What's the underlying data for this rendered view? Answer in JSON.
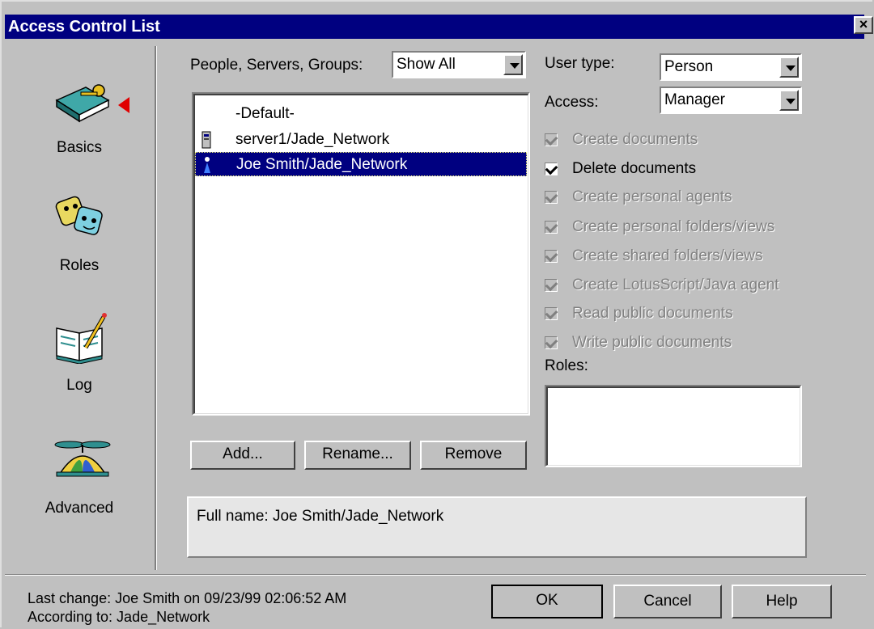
{
  "window": {
    "title": "Access Control List",
    "close_glyph": "×"
  },
  "sidebar": {
    "items": [
      {
        "label": "Basics",
        "icon": "book-key-icon",
        "active": true
      },
      {
        "label": "Roles",
        "icon": "masks-icon"
      },
      {
        "label": "Log",
        "icon": "open-book-pencil-icon"
      },
      {
        "label": "Advanced",
        "icon": "propeller-beanie-icon"
      }
    ]
  },
  "filter": {
    "label": "People, Servers, Groups:",
    "value": "Show All"
  },
  "user_type": {
    "label": "User type:",
    "value": "Person"
  },
  "access": {
    "label": "Access:",
    "value": "Manager"
  },
  "entries": [
    {
      "name": "-Default-",
      "icon": ""
    },
    {
      "name": "server1/Jade_Network",
      "icon": "server-icon"
    },
    {
      "name": "Joe Smith/Jade_Network",
      "icon": "person-icon",
      "selected": true
    }
  ],
  "permissions": [
    {
      "label": "Create documents",
      "checked": true,
      "enabled": false
    },
    {
      "label": "Delete documents",
      "checked": true,
      "enabled": true
    },
    {
      "label": "Create personal agents",
      "checked": true,
      "enabled": false
    },
    {
      "label": "Create personal folders/views",
      "checked": true,
      "enabled": false
    },
    {
      "label": "Create shared folders/views",
      "checked": true,
      "enabled": false
    },
    {
      "label": "Create LotusScript/Java agent",
      "checked": true,
      "enabled": false
    },
    {
      "label": "Read public documents",
      "checked": true,
      "enabled": false
    },
    {
      "label": "Write public documents",
      "checked": true,
      "enabled": false
    }
  ],
  "roles": {
    "label": "Roles:"
  },
  "list_buttons": {
    "add": "Add...",
    "rename": "Rename...",
    "remove": "Remove"
  },
  "full_name": "Full name:  Joe Smith/Jade_Network",
  "footer": {
    "last_change": "Last change:  Joe Smith on 09/23/99 02:06:52 AM",
    "according_to": "According to:  Jade_Network",
    "ok": "OK",
    "cancel": "Cancel",
    "help": "Help"
  },
  "colors": {
    "titlebar": "#000080",
    "selection": "#000080",
    "face": "#c0c0c0",
    "active_marker": "#e00000"
  }
}
